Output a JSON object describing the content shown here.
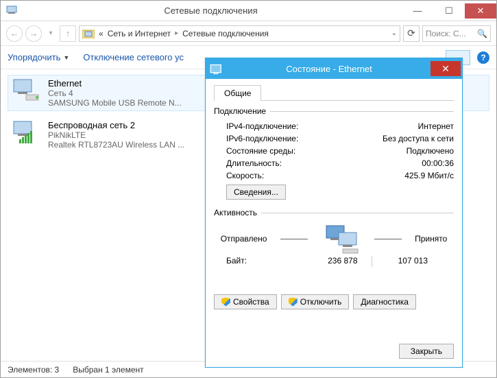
{
  "window": {
    "title": "Сетевые подключения",
    "breadcrumb_prefix": "«",
    "breadcrumb_1": "Сеть и Интернет",
    "breadcrumb_2": "Сетевые подключения",
    "search_placeholder": "Поиск: С...",
    "organize": "Упорядочить",
    "disable": "Отключение сетевого ус"
  },
  "items": [
    {
      "title": "Ethernet",
      "line2": "Сеть  4",
      "line3": "SAMSUNG Mobile USB Remote N..."
    },
    {
      "title": "Беспроводная сеть 2",
      "line2": "PikNikLTE",
      "line3": "Realtek RTL8723AU Wireless LAN ..."
    }
  ],
  "status": {
    "count": "Элементов: 3",
    "selected": "Выбран 1 элемент"
  },
  "dialog": {
    "title": "Состояние - Ethernet",
    "tab_general": "Общие",
    "section_connection": "Подключение",
    "ipv4_label": "IPv4-подключение:",
    "ipv4_value": "Интернет",
    "ipv6_label": "IPv6-подключение:",
    "ipv6_value": "Без доступа к сети",
    "media_label": "Состояние среды:",
    "media_value": "Подключено",
    "duration_label": "Длительность:",
    "duration_value": "00:00:36",
    "speed_label": "Скорость:",
    "speed_value": "425.9 Мбит/с",
    "details_btn": "Сведения...",
    "section_activity": "Активность",
    "sent_label": "Отправлено",
    "recv_label": "Принято",
    "bytes_label": "Байт:",
    "bytes_sent": "236 878",
    "bytes_recv": "107 013",
    "props_btn": "Свойства",
    "disable_btn": "Отключить",
    "diag_btn": "Диагностика",
    "close_btn": "Закрыть"
  }
}
